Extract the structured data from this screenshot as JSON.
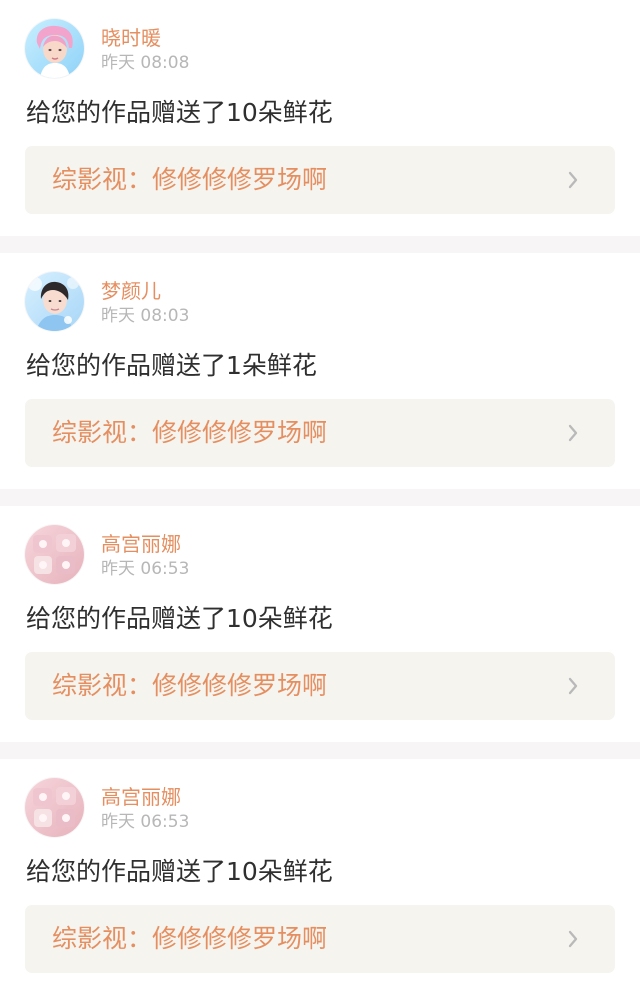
{
  "feed": {
    "items": [
      {
        "username": "晓时暖",
        "timestamp": "昨天 08:08",
        "message": "给您的作品赠送了10朵鲜花",
        "work_title": "综影视：修修修修罗场啊"
      },
      {
        "username": "梦颜儿",
        "timestamp": "昨天 08:03",
        "message": "给您的作品赠送了1朵鲜花",
        "work_title": "综影视：修修修修罗场啊"
      },
      {
        "username": "高宫丽娜",
        "timestamp": "昨天 06:53",
        "message": "给您的作品赠送了10朵鲜花",
        "work_title": "综影视：修修修修罗场啊"
      },
      {
        "username": "高宫丽娜",
        "timestamp": "昨天 06:53",
        "message": "给您的作品赠送了10朵鲜花",
        "work_title": "综影视：修修修修罗场啊"
      }
    ]
  },
  "colors": {
    "accent": "#e58f61",
    "indicator": "#ea6a98",
    "message_text": "#2f2f2f",
    "timestamp_text": "#b7b7b7",
    "card_link_bg": "#f5f4ef",
    "divider_bg": "#f7f5f5"
  },
  "icons": {
    "chevron": "chevron-right-icon"
  }
}
